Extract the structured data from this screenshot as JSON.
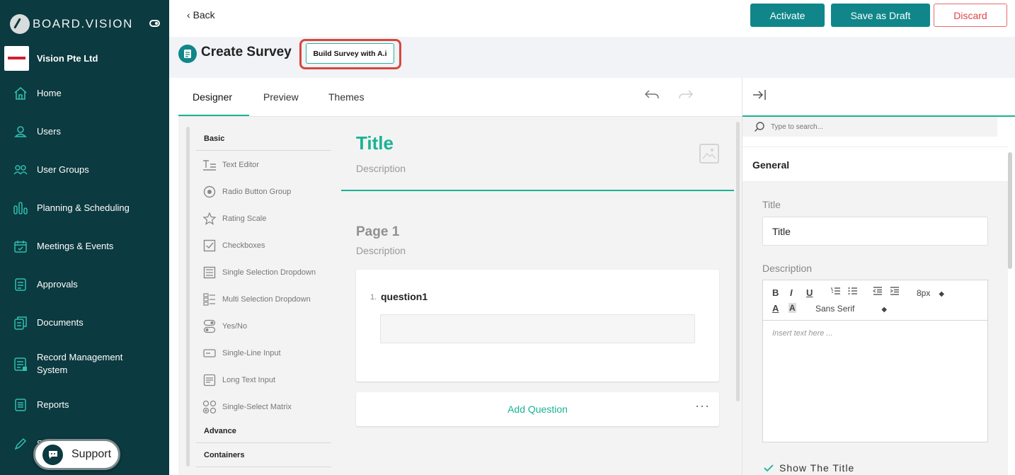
{
  "brand": {
    "name": "BOARD.VISION"
  },
  "organization": {
    "name": "Vision Pte Ltd"
  },
  "sidebar": {
    "items": [
      {
        "label": "Home",
        "icon": "home-icon"
      },
      {
        "label": "Users",
        "icon": "user-icon"
      },
      {
        "label": "User Groups",
        "icon": "user-groups-icon"
      },
      {
        "label": "Planning & Scheduling",
        "icon": "planning-icon"
      },
      {
        "label": "Meetings & Events",
        "icon": "calendar-icon"
      },
      {
        "label": "Approvals",
        "icon": "approvals-icon"
      },
      {
        "label": "Documents",
        "icon": "documents-icon"
      },
      {
        "label": "Record Management System",
        "icon": "record-management-icon"
      },
      {
        "label": "Reports",
        "icon": "reports-icon"
      },
      {
        "label": "Sur(?)",
        "icon": "pen-icon"
      }
    ],
    "support_label": "Support"
  },
  "topbar": {
    "back_label": "Back",
    "activate_label": "Activate",
    "save_draft_label": "Save as Draft",
    "discard_label": "Discard"
  },
  "header": {
    "title": "Create Survey",
    "ai_button_label": "Build Survey with A.i"
  },
  "designer": {
    "tabs": [
      {
        "label": "Designer"
      },
      {
        "label": "Preview"
      },
      {
        "label": "Themes"
      }
    ],
    "active_tab": "Designer"
  },
  "toolbox": {
    "categories": {
      "basic": "Basic",
      "advance": "Advance",
      "containers": "Containers"
    },
    "items": [
      {
        "label": "Text Editor",
        "icon": "text-editor-icon"
      },
      {
        "label": "Radio Button Group",
        "icon": "radio-icon"
      },
      {
        "label": "Rating Scale",
        "icon": "star-icon"
      },
      {
        "label": "Checkboxes",
        "icon": "checkbox-icon"
      },
      {
        "label": "Single Selection Dropdown",
        "icon": "dropdown-icon"
      },
      {
        "label": "Multi Selection Dropdown",
        "icon": "multi-dropdown-icon"
      },
      {
        "label": "Yes/No",
        "icon": "toggle-icon"
      },
      {
        "label": "Single-Line Input",
        "icon": "single-line-input-icon"
      },
      {
        "label": "Long Text Input",
        "icon": "long-text-icon"
      },
      {
        "label": "Single-Select Matrix",
        "icon": "matrix-icon"
      }
    ]
  },
  "canvas": {
    "survey_title": "Title",
    "survey_description": "Description",
    "page_title": "Page 1",
    "page_description": "Description",
    "question_number": "1.",
    "question_title": "question1",
    "add_question_label": "Add Question",
    "more_label": "···"
  },
  "properties": {
    "search_placeholder": "Type to search...",
    "section_title": "General",
    "title_label": "Title",
    "title_value": "Title",
    "description_label": "Description",
    "editor": {
      "font_size": "8px",
      "font_family": "Sans Serif",
      "placeholder": "Insert text here ..."
    },
    "show_title_label": "Show The Title"
  },
  "colors": {
    "sidebar_bg": "#0b3a40",
    "primary": "#10868a",
    "accent": "#19b394",
    "discard": "#e0454b",
    "highlight": "#d9463c"
  }
}
